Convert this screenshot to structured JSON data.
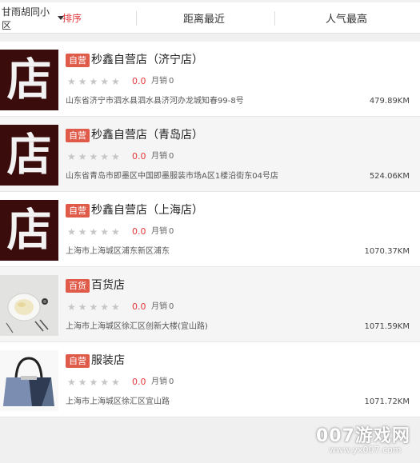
{
  "sort_bar": {
    "location_label": "甘雨胡同小区",
    "default_label": "排序",
    "distance_label": "距离最近",
    "popularity_label": "人气最高"
  },
  "stores": [
    {
      "badge": "自营",
      "name": "秒鑫自营店（济宁店）",
      "thumb_char": "店",
      "stars": "★★★★★",
      "score": "0.0",
      "sales_label": "月销",
      "sales": "0",
      "address": "山东省济宁市泗水县泗水县济河办龙城知春99-8号",
      "distance": "479.89KM"
    },
    {
      "badge": "自营",
      "name": "秒鑫自营店（青岛店）",
      "thumb_char": "店",
      "stars": "★★★★★",
      "score": "0.0",
      "sales_label": "月销",
      "sales": "0",
      "address": "山东省青岛市即墨区中国即墨服装市场A区1楼沿街东04号店",
      "distance": "524.06KM"
    },
    {
      "badge": "自营",
      "name": "秒鑫自营店（上海店）",
      "thumb_char": "店",
      "stars": "★★★★★",
      "score": "0.0",
      "sales_label": "月销",
      "sales": "0",
      "address": "上海市上海城区浦东新区浦东",
      "distance": "1070.37KM"
    },
    {
      "badge": "百货",
      "name": "百货店",
      "stars": "★★★★★",
      "score": "0.0",
      "sales_label": "月销",
      "sales": "0",
      "address": "上海市上海城区徐汇区创新大楼(宜山路)",
      "distance": "1071.59KM"
    },
    {
      "badge": "自营",
      "name": "服装店",
      "stars": "★★★★★",
      "score": "0.0",
      "sales_label": "月销",
      "sales": "0",
      "address": "上海市上海城区徐汇区宜山路",
      "distance": "1071.72KM"
    }
  ],
  "watermark": {
    "main": "007游戏网",
    "sub": "www.yx007.com"
  },
  "colors": {
    "accent": "#e4393c",
    "badge": "#e05a4a",
    "thumb_dark": "#3a0c0c"
  }
}
